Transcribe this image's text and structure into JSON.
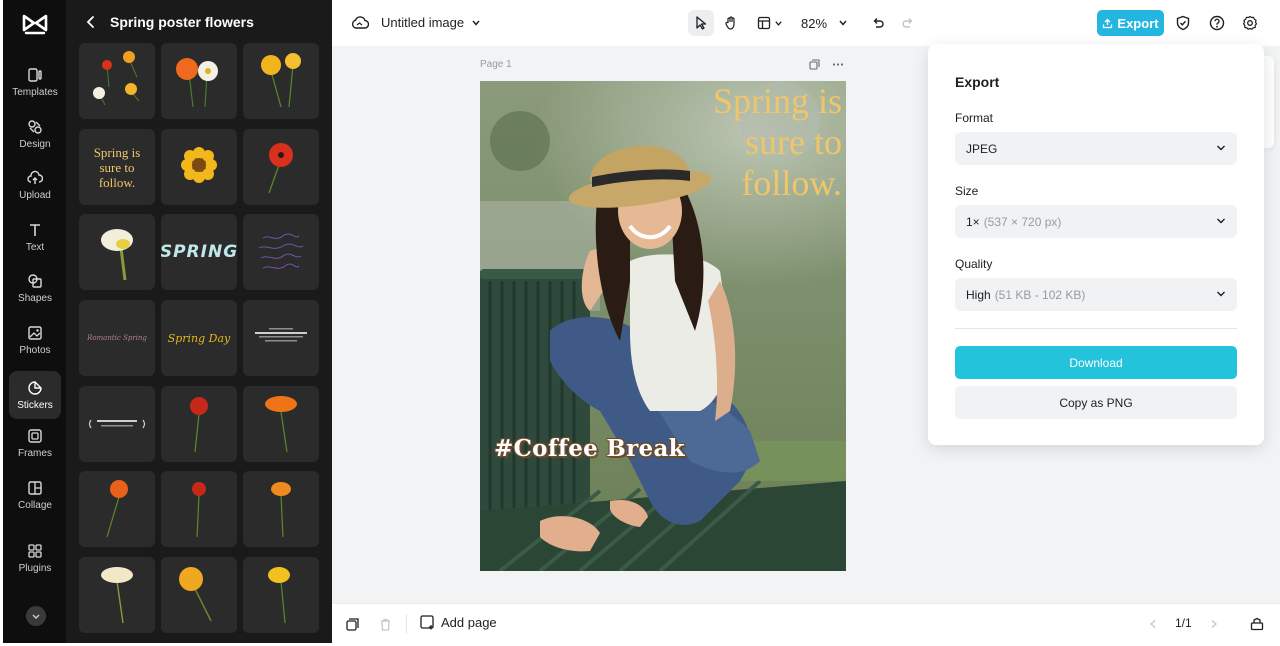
{
  "rail": {
    "items": [
      {
        "label": "Templates",
        "icon": "templates-icon"
      },
      {
        "label": "Design",
        "icon": "design-icon"
      },
      {
        "label": "Upload",
        "icon": "upload-cloud-icon"
      },
      {
        "label": "Text",
        "icon": "text-icon"
      },
      {
        "label": "Shapes",
        "icon": "shapes-icon"
      },
      {
        "label": "Photos",
        "icon": "photos-icon"
      },
      {
        "label": "Stickers",
        "icon": "stickers-icon"
      },
      {
        "label": "Frames",
        "icon": "frames-icon"
      },
      {
        "label": "Collage",
        "icon": "collage-icon"
      },
      {
        "label": "Plugins",
        "icon": "plugins-icon"
      }
    ],
    "active": "Stickers"
  },
  "panel": {
    "title": "Spring poster flowers",
    "tile_texts": {
      "spring_is": "Spring is\nsure to\nfollow.",
      "spring_bold": "SPRING",
      "romantic": "Romantic Spring",
      "spring_day": "Spring Day"
    }
  },
  "topbar": {
    "filename": "Untitled image",
    "zoom": "82%",
    "export_label": "Export"
  },
  "canvas": {
    "page_label": "Page 1",
    "poster_text": "Spring is\nsure to\nfollow.",
    "coffee_text": "#Coffee Break"
  },
  "bottombar": {
    "add_page": "Add page",
    "page_count": "1/1"
  },
  "export_panel": {
    "title": "Export",
    "format_label": "Format",
    "format_value": "JPEG",
    "size_label": "Size",
    "size_value": "1×",
    "size_detail": "(537 × 720 px)",
    "quality_label": "Quality",
    "quality_value": "High",
    "quality_detail": "(51 KB - 102 KB)",
    "download_label": "Download",
    "copy_label": "Copy as PNG"
  },
  "colors": {
    "accent": "#23b6e0",
    "download": "#23c3dc",
    "rail_bg": "#0e0e0e",
    "panel_bg": "#1a1a1a",
    "tile_bg": "#2b2b2b",
    "poster_text": "#f0c66a"
  }
}
